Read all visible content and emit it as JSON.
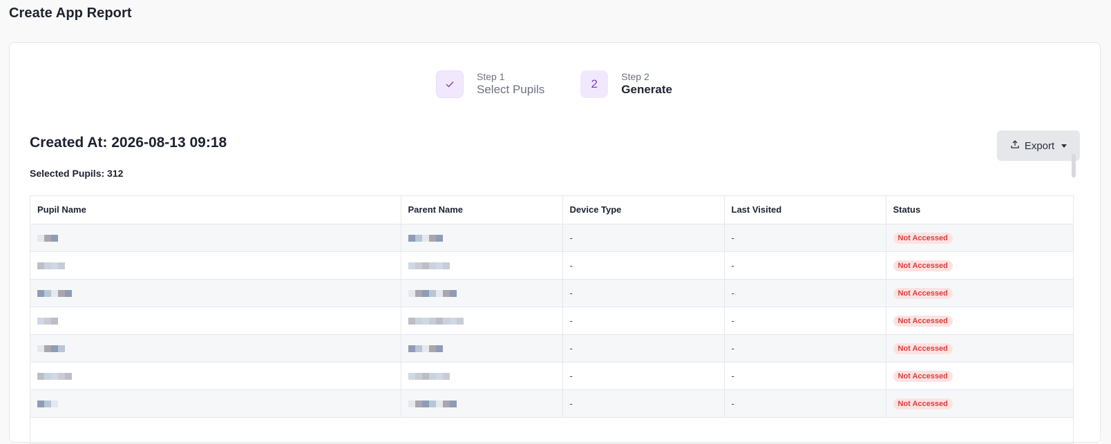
{
  "page": {
    "title": "Create App Report"
  },
  "stepper": {
    "steps": [
      {
        "number": "Step 1",
        "label": "Select Pupils",
        "badge": "✓",
        "state": "completed"
      },
      {
        "number": "Step 2",
        "label": "Generate",
        "badge": "2",
        "state": "active"
      }
    ]
  },
  "report": {
    "created_at": "Created At: 2026-08-13 09:18",
    "selected_pupils": "Selected Pupils: 312",
    "export_label": "Export",
    "export_icon": "upload-icon"
  },
  "table": {
    "columns": [
      "Pupil Name",
      "Parent Name",
      "Device Type",
      "Last Visited",
      "Status"
    ],
    "rows": [
      {
        "device": "-",
        "last_visited": "-",
        "status": "Not Accessed"
      },
      {
        "device": "-",
        "last_visited": "-",
        "status": "Not Accessed"
      },
      {
        "device": "-",
        "last_visited": "-",
        "status": "Not Accessed"
      },
      {
        "device": "-",
        "last_visited": "-",
        "status": "Not Accessed"
      },
      {
        "device": "-",
        "last_visited": "-",
        "status": "Not Accessed"
      },
      {
        "device": "-",
        "last_visited": "-",
        "status": "Not Accessed"
      },
      {
        "device": "-",
        "last_visited": "-",
        "status": "Not Accessed"
      }
    ]
  },
  "colors": {
    "accent": "#7b3fd0",
    "badge_bg": "#f1e8fd",
    "status_bg": "#fde2e2",
    "status_text": "#dc3c3c"
  }
}
